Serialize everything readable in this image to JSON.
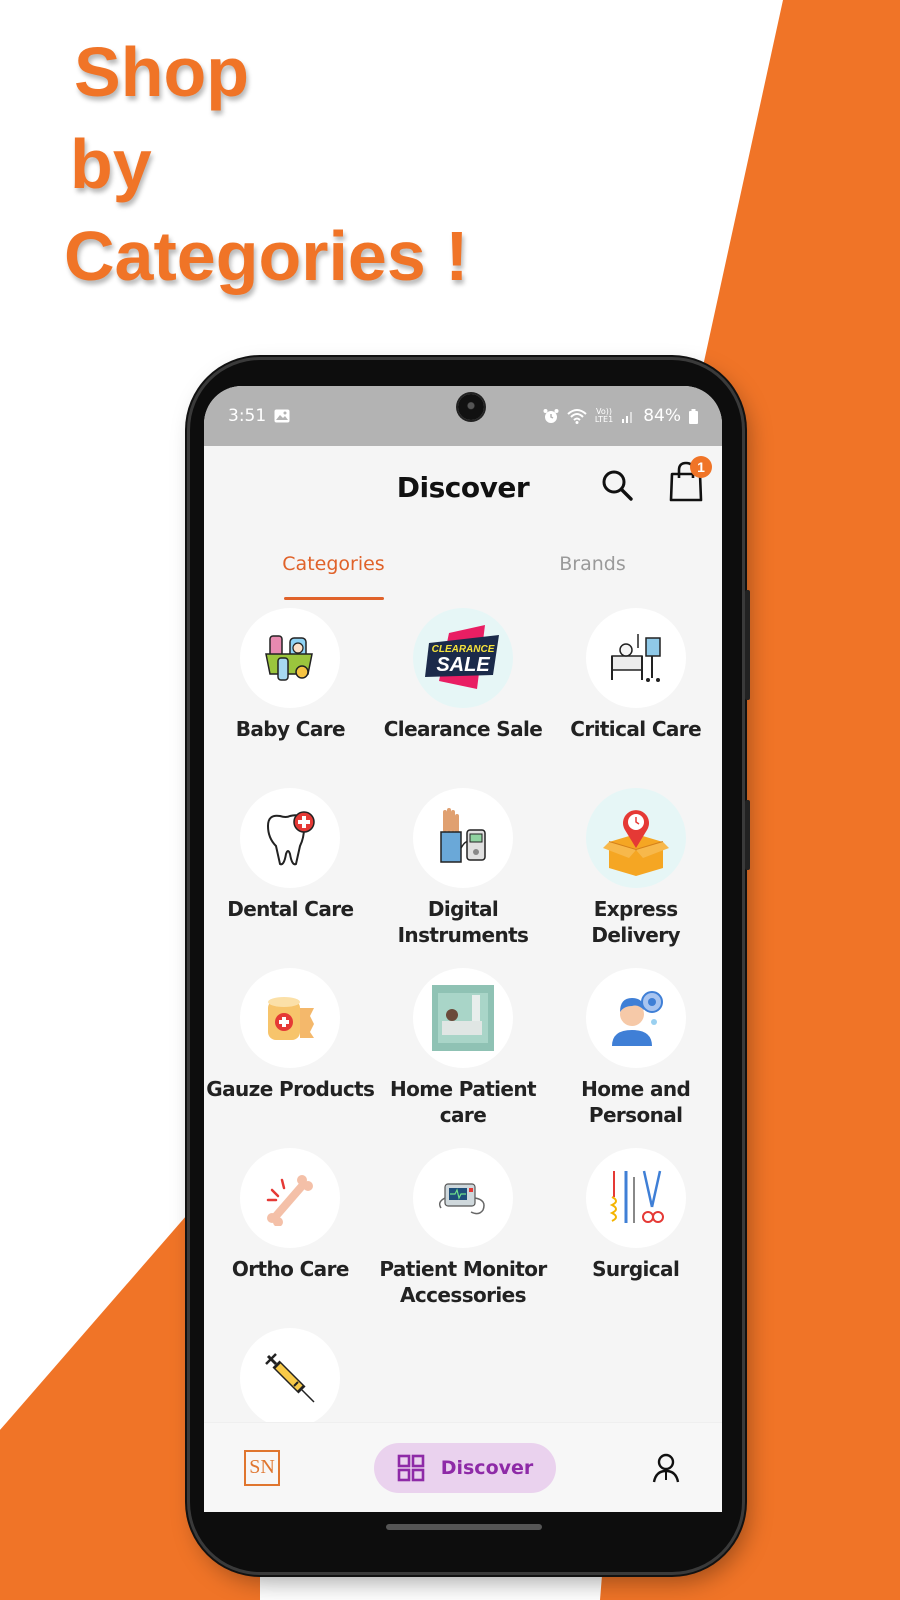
{
  "promo": {
    "headline": [
      "Shop",
      "by",
      "Categories !"
    ],
    "brand_color": "#f07427"
  },
  "status_bar": {
    "time": "3:51",
    "battery": "84%",
    "icons": [
      "image-icon",
      "alarm-icon",
      "wifi-icon",
      "volte-icon",
      "signal-icon",
      "battery-icon"
    ],
    "network_label": "VoLTE1"
  },
  "header": {
    "title": "Discover",
    "cart_count": "1"
  },
  "tabs": [
    {
      "label": "Categories",
      "active": true
    },
    {
      "label": "Brands",
      "active": false
    }
  ],
  "categories": [
    {
      "label": "Baby Care",
      "icon": "baby-care-icon"
    },
    {
      "label": "Clearance Sale",
      "icon": "clearance-sale-icon"
    },
    {
      "label": "Critical Care",
      "icon": "critical-care-icon"
    },
    {
      "label": "Dental Care",
      "icon": "dental-care-icon"
    },
    {
      "label": "Digital Instruments",
      "icon": "digital-instruments-icon"
    },
    {
      "label": "Express Delivery",
      "icon": "express-delivery-icon"
    },
    {
      "label": "Gauze Products",
      "icon": "gauze-products-icon"
    },
    {
      "label": "Home Patient care",
      "icon": "home-patient-care-icon"
    },
    {
      "label": "Home and Personal",
      "icon": "home-personal-icon"
    },
    {
      "label": "Ortho Care",
      "icon": "ortho-care-icon"
    },
    {
      "label": "Patient Monitor Accessories",
      "icon": "patient-monitor-icon"
    },
    {
      "label": "Surgical",
      "icon": "surgical-icon"
    },
    {
      "label": "",
      "icon": "syringe-icon"
    }
  ],
  "bottom_nav": {
    "logo_text": "SN",
    "discover_label": "Discover",
    "accent": "#8e2aa7"
  }
}
